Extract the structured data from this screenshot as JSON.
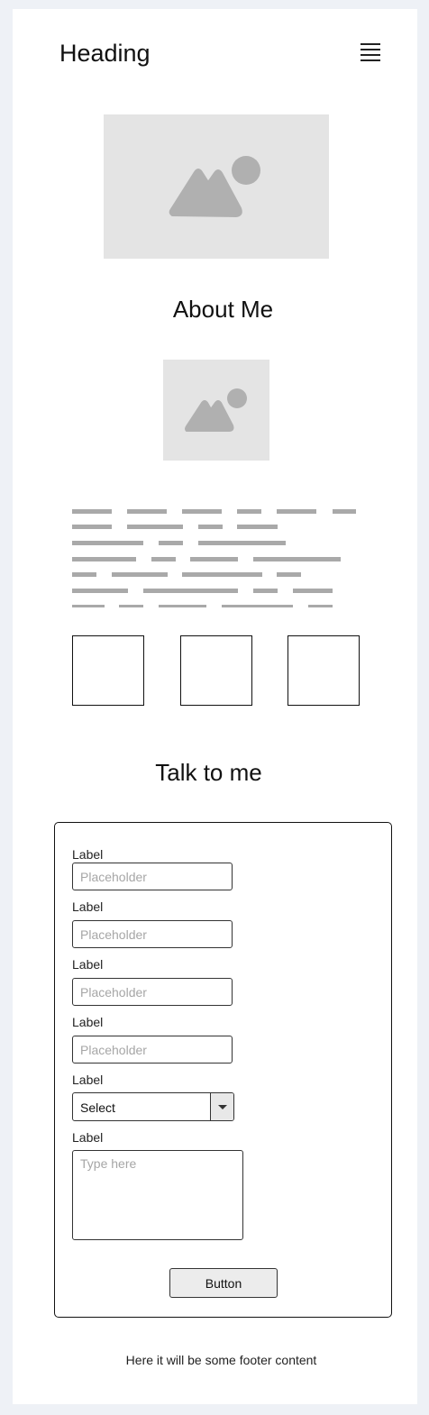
{
  "header": {
    "title": "Heading",
    "menu_icon": "hamburger-menu-icon"
  },
  "hero_image": {
    "icon": "image-placeholder-icon"
  },
  "about": {
    "title": "About Me",
    "portrait_icon": "image-placeholder-icon"
  },
  "contact": {
    "title": "Talk to me",
    "fields": [
      {
        "label": "Label",
        "placeholder": "Placeholder",
        "value": ""
      },
      {
        "label": "Label",
        "placeholder": "Placeholder",
        "value": ""
      },
      {
        "label": "Label",
        "placeholder": "Placeholder",
        "value": ""
      },
      {
        "label": "Label",
        "placeholder": "Placeholder",
        "value": ""
      }
    ],
    "select": {
      "label": "Label",
      "value": "Select"
    },
    "textarea": {
      "label": "Label",
      "placeholder": "Type here"
    },
    "button_label": "Button"
  },
  "footer": {
    "text": "Here it will be some footer content"
  },
  "colors": {
    "page_background": "#eef1f6",
    "placeholder_fill": "#e4e4e4",
    "placeholder_icon": "#b0b0b0",
    "lorem_bar": "#a9a9a9"
  }
}
